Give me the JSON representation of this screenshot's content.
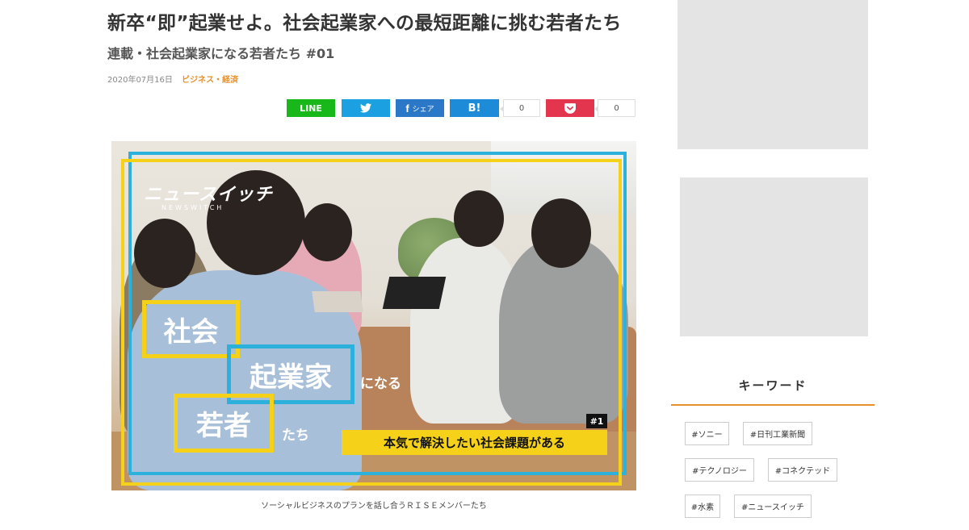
{
  "article": {
    "title": "新卒“即”起業せよ。社会起業家への最短距離に挑む若者たち",
    "subtitle": "連載・社会起業家になる若者たち #01",
    "date": "2020年07月16日",
    "category": "ビジネス・経済"
  },
  "share": {
    "line_label": "LINE",
    "twitter_icon": "twitter-bird-icon",
    "facebook_label": "シェア",
    "hatena_label": "B!",
    "hatena_count": "0",
    "pocket_count": "0",
    "colors": {
      "line": "#18b81a",
      "twitter": "#1ba1e2",
      "facebook": "#2b78c8",
      "hatena": "#1d8bd8",
      "pocket": "#e3354e"
    }
  },
  "hero": {
    "logo": "ニュースイッチ",
    "logo_sub": "NEWSWITCH",
    "word1": "社会",
    "word2": "起業家",
    "suffix1": "になる",
    "word3": "若者",
    "suffix2": "たち",
    "episode": "#1",
    "banner": "本気で解決したい社会課題がある",
    "colors": {
      "yellow": "#f5d11a",
      "blue": "#2bb1dc"
    }
  },
  "caption": "ソーシャルビジネスのプランを話し合うＲＩＳＥメンバーたち",
  "sidebar": {
    "keyword_heading": "キーワード",
    "accent": "#e8902c",
    "tags": [
      "#ソニー",
      "#日刊工業新聞",
      "#テクノロジー",
      "#コネクテッド",
      "#水素",
      "#ニュースイッチ"
    ]
  }
}
